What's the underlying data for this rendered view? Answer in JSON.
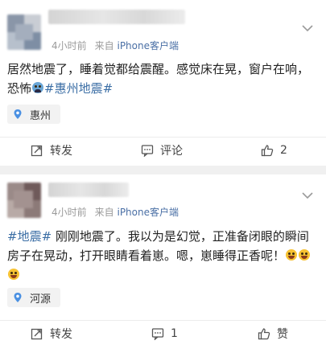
{
  "feed": {
    "posts": [
      {
        "time": "4小时前",
        "source_prefix": "来自",
        "source_app": "iPhone客户端",
        "text_before": "居然地震了，睡着觉都给震醒。感觉床在晃，窗户在响，恐怖",
        "emoji_icon": "fearful-face-emoji",
        "topic": "#惠州地震#",
        "location": "惠州",
        "repost_label": "转发",
        "comment_label": "评论",
        "like_value": "2"
      },
      {
        "time": "4小时前",
        "source_prefix": "来自",
        "source_app": "iPhone客户端",
        "topic": "#地震#",
        "text_line1": " 刚刚地震了。我以为是幻觉，正准备闭眼的瞬间",
        "text_line2": "房子在晃动，打开眼睛看着崽。嗯，崽睡得正香呢！",
        "emoji_icon": "laughing-face-emoji",
        "location": "河源",
        "repost_label": "转发",
        "comment_value": "1",
        "like_label": "赞"
      }
    ]
  },
  "colors": {
    "topic": "#3b6ea5",
    "meta": "#9b9b9b",
    "background": "#f0f0f0",
    "pin": "#4a90e2"
  }
}
